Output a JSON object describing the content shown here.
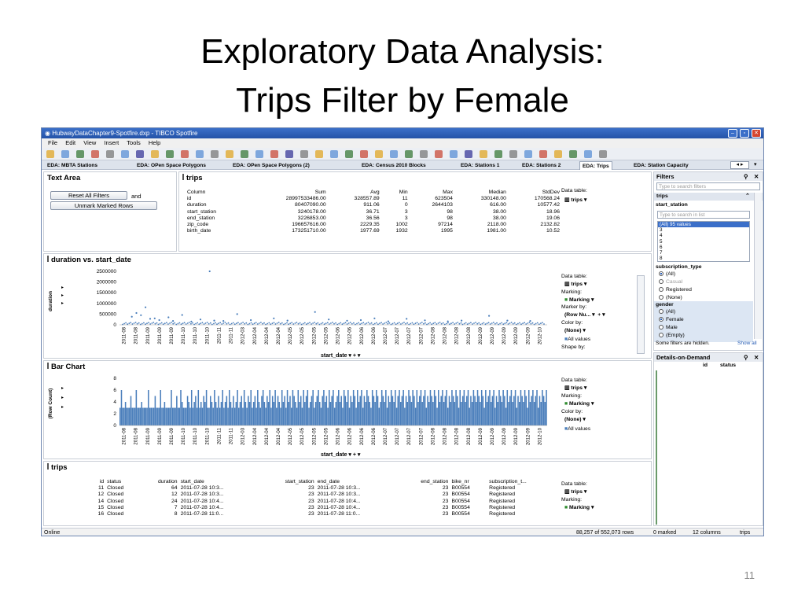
{
  "slide": {
    "title_line1": "Exploratory Data Analysis:",
    "title_line2": "Trips Filter by Female",
    "page_number": "11"
  },
  "window": {
    "title": "HubwayDataChapter9-Spotfire.dxp - TIBCO Spotfire",
    "menu": [
      "File",
      "Edit",
      "View",
      "Insert",
      "Tools",
      "Help"
    ],
    "tabs": [
      "EDA: MBTA Stations",
      "EDA: OPen Space Polygons",
      "EDA: OPen Space Polygons (2)",
      "EDA: Census 2010 Blocks",
      "EDA: Stations 1",
      "EDA: Stations 2",
      "EDA: Trips",
      "EDA: Station Capacity"
    ],
    "active_tab": "EDA: Trips"
  },
  "text_area": {
    "title": "Text Area",
    "reset_button": "Reset All Filters",
    "and_label": "and",
    "unmark_button": "Unmark Marked Rows"
  },
  "stats_table": {
    "title": "trips",
    "headers": [
      "Column",
      "Sum",
      "Avg",
      "Min",
      "Max",
      "Median",
      "StdDev"
    ],
    "rows": [
      [
        "id",
        "28997533486.00",
        "328557.89",
        "11",
        "623504",
        "330148.00",
        "170568.24"
      ],
      [
        "duration",
        "80407090.00",
        "911.06",
        "0",
        "2644103",
        "616.00",
        "10577.42"
      ],
      [
        "start_station",
        "3240178.00",
        "36.71",
        "3",
        "98",
        "38.00",
        "18.96"
      ],
      [
        "end_station",
        "3226853.00",
        "36.56",
        "3",
        "98",
        "38.00",
        "19.06"
      ],
      [
        "zip_code",
        "196657616.00",
        "2229.35",
        "1002",
        "97214",
        "2118.00",
        "2132.82"
      ],
      [
        "birth_date",
        "173251710.00",
        "1977.69",
        "1932",
        "1995",
        "1981.00",
        "10.52"
      ]
    ],
    "data_table_label": "Data table:",
    "data_table_value": "trips"
  },
  "scatter": {
    "title": "duration vs. start_date",
    "ylabel": "duration",
    "y_ticks": [
      "2500000",
      "2000000",
      "1500000",
      "1000000",
      "500000",
      "0"
    ],
    "x_axis_selector": "start_date",
    "data_table_label": "Data table:",
    "data_table_value": "trips",
    "marking_label": "Marking:",
    "marking_value": "Marking",
    "marker_by_label": "Marker by:",
    "marker_by_value": "(Row Nu...",
    "color_by_label": "Color by:",
    "color_by_value": "(None)",
    "all_values": "All values",
    "shape_by_label": "Shape by:"
  },
  "bar_chart": {
    "title": "Bar Chart",
    "ylabel": "(Row Count)",
    "y_ticks": [
      "8",
      "6",
      "4",
      "2",
      "0"
    ],
    "x_axis_selector": "start_date",
    "data_table_label": "Data table:",
    "data_table_value": "trips",
    "marking_label": "Marking:",
    "marking_value": "Marking",
    "color_by_label": "Color by:",
    "color_by_value": "(None)",
    "all_values": "All values"
  },
  "chart_data": [
    {
      "type": "scatter",
      "title": "duration vs. start_date",
      "xlabel": "start_date",
      "ylabel": "duration",
      "ylim": [
        0,
        2500000
      ],
      "x_tick_labels": [
        "2011-08",
        "2011-08",
        "2011-09",
        "2011-09",
        "2011-09",
        "2011-10",
        "2011-10",
        "2011-10",
        "2011-11",
        "2011-11",
        "2012-03",
        "2012-04",
        "2012-04",
        "2012-04",
        "2012-05",
        "2012-05",
        "2012-05",
        "2012-05",
        "2012-06",
        "2012-06",
        "2012-06",
        "2012-06",
        "2012-07",
        "2012-07",
        "2012-07",
        "2012-07",
        "2012-08",
        "2012-08",
        "2012-08",
        "2012-08",
        "2012-09",
        "2012-09",
        "2012-09",
        "2012-09",
        "2012-09",
        "2012-10"
      ],
      "highlight_points": [
        {
          "x": 2,
          "y": 380000
        },
        {
          "x": 3,
          "y": 550000
        },
        {
          "x": 4,
          "y": 450000
        },
        {
          "x": 5,
          "y": 820000
        },
        {
          "x": 6,
          "y": 280000
        },
        {
          "x": 7,
          "y": 300000
        },
        {
          "x": 8,
          "y": 220000
        },
        {
          "x": 10,
          "y": 350000
        },
        {
          "x": 11,
          "y": 180000
        },
        {
          "x": 13,
          "y": 460000
        },
        {
          "x": 15,
          "y": 150000
        },
        {
          "x": 17,
          "y": 250000
        },
        {
          "x": 19,
          "y": 2600000
        },
        {
          "x": 20,
          "y": 200000
        },
        {
          "x": 22,
          "y": 180000
        },
        {
          "x": 25,
          "y": 500000
        },
        {
          "x": 28,
          "y": 220000
        },
        {
          "x": 33,
          "y": 300000
        },
        {
          "x": 36,
          "y": 200000
        },
        {
          "x": 42,
          "y": 600000
        },
        {
          "x": 45,
          "y": 250000
        },
        {
          "x": 49,
          "y": 190000
        },
        {
          "x": 52,
          "y": 220000
        },
        {
          "x": 55,
          "y": 300000
        },
        {
          "x": 58,
          "y": 160000
        },
        {
          "x": 62,
          "y": 280000
        },
        {
          "x": 66,
          "y": 210000
        },
        {
          "x": 71,
          "y": 160000
        },
        {
          "x": 74,
          "y": 200000
        },
        {
          "x": 80,
          "y": 420000
        },
        {
          "x": 84,
          "y": 200000
        },
        {
          "x": 89,
          "y": 180000
        }
      ]
    },
    {
      "type": "bar",
      "title": "Bar Chart",
      "ylabel": "(Row Count)",
      "xlabel": "start_date",
      "ylim": [
        0,
        8
      ],
      "x_tick_labels": [
        "2011-08",
        "2011-08",
        "2011-09",
        "2011-09",
        "2011-09",
        "2011-10",
        "2011-10",
        "2011-10",
        "2011-11",
        "2011-11",
        "2012-03",
        "2012-04",
        "2012-04",
        "2012-04",
        "2012-05",
        "2012-05",
        "2012-05",
        "2012-05",
        "2012-06",
        "2012-06",
        "2012-06",
        "2012-06",
        "2012-07",
        "2012-07",
        "2012-07",
        "2012-07",
        "2012-08",
        "2012-08",
        "2012-08",
        "2012-08",
        "2012-09",
        "2012-09",
        "2012-09",
        "2012-09",
        "2012-09",
        "2012-10"
      ],
      "values": [
        3,
        6,
        3,
        3,
        4,
        3,
        3,
        3,
        5,
        3,
        3,
        3,
        6,
        3,
        3,
        3,
        4,
        3,
        3,
        3,
        3,
        6,
        3,
        3,
        3,
        3,
        5,
        3,
        3,
        3,
        6,
        3,
        3,
        4,
        3,
        3,
        3,
        3,
        6,
        3,
        3,
        3,
        5,
        3,
        3,
        6,
        4,
        3,
        3,
        3,
        5,
        4,
        3,
        6,
        3,
        4,
        5,
        3,
        6,
        3,
        4,
        3,
        5,
        4,
        6,
        3,
        3,
        5,
        4,
        3,
        6,
        4,
        3,
        5,
        3,
        4,
        6,
        3,
        4,
        5,
        3,
        6,
        4,
        3,
        5,
        3,
        4,
        6,
        3,
        4,
        5,
        3,
        6,
        4,
        3,
        5,
        4,
        6,
        3,
        4,
        5,
        3,
        6,
        4,
        3,
        5,
        6,
        4,
        3,
        5,
        4,
        6,
        3,
        5,
        4,
        6,
        3,
        5,
        4,
        3,
        6,
        4,
        5,
        3,
        6,
        4,
        5,
        3,
        6,
        5,
        4,
        3,
        6,
        4,
        5,
        3,
        6,
        4,
        5,
        6,
        3,
        4,
        5,
        6,
        3,
        4,
        5,
        6,
        4,
        3,
        5,
        6,
        4,
        5,
        3,
        6,
        4,
        5,
        6,
        3,
        4,
        5,
        6,
        4,
        5,
        3,
        6,
        5,
        4,
        6,
        3,
        5,
        4,
        6,
        5,
        3,
        6,
        4,
        5,
        6,
        3,
        5,
        4,
        6,
        5,
        4,
        3,
        6,
        5,
        4,
        6,
        5,
        3,
        4,
        6,
        5,
        4,
        6,
        3,
        5,
        4,
        6,
        5,
        4,
        6,
        3,
        5,
        6,
        4,
        5,
        6,
        3,
        5,
        4,
        6,
        5,
        4,
        6,
        5,
        3,
        6,
        4,
        5,
        6,
        4,
        5,
        6,
        3,
        5,
        4,
        6,
        5,
        4,
        6,
        5,
        3,
        6,
        4,
        5,
        6,
        4,
        5,
        6,
        3,
        5,
        4,
        6,
        5,
        4,
        6,
        5,
        3,
        6,
        4,
        5,
        6,
        4,
        5,
        6,
        3,
        5,
        4,
        6,
        5,
        4,
        6,
        5,
        4,
        6,
        5,
        3,
        6,
        4,
        5,
        6,
        4,
        5,
        6,
        3,
        5,
        4,
        6,
        5,
        4,
        6,
        5,
        3,
        6,
        4,
        5,
        6,
        4,
        5,
        6,
        3,
        5,
        4,
        6,
        5,
        4,
        6,
        5,
        3,
        6,
        4,
        5,
        6,
        4,
        5,
        6,
        3,
        5,
        4,
        6,
        5,
        4,
        6
      ]
    }
  ],
  "trips_table": {
    "title": "trips",
    "headers": [
      "id",
      "status",
      "duration",
      "start_date",
      "start_station",
      "end_date",
      "end_station",
      "bike_nr",
      "subscription_t..."
    ],
    "rows": [
      [
        "11",
        "Closed",
        "64",
        "2011-07-28 10:3...",
        "23",
        "2011-07-28 10:3...",
        "23",
        "B00554",
        "Registered"
      ],
      [
        "12",
        "Closed",
        "12",
        "2011-07-28 10:3...",
        "23",
        "2011-07-28 10:3...",
        "23",
        "B00554",
        "Registered"
      ],
      [
        "14",
        "Closed",
        "24",
        "2011-07-28 10:4...",
        "23",
        "2011-07-28 10:4...",
        "23",
        "B00554",
        "Registered"
      ],
      [
        "15",
        "Closed",
        "7",
        "2011-07-28 10:4...",
        "23",
        "2011-07-28 10:4...",
        "23",
        "B00554",
        "Registered"
      ],
      [
        "16",
        "Closed",
        "8",
        "2011-07-28 11:0...",
        "23",
        "2011-07-28 11:0...",
        "23",
        "B00554",
        "Registered"
      ]
    ],
    "data_table_label": "Data table:",
    "data_table_value": "trips",
    "marking_label": "Marking:",
    "marking_value": "Marking"
  },
  "filters": {
    "title": "Filters",
    "search_placeholder": "Type to search filters",
    "table_name": "trips",
    "start_station_label": "start_station",
    "list_search_placeholder": "Type to search in list",
    "list_items": [
      "(All) 95 values",
      "3",
      "4",
      "5",
      "6",
      "7",
      "8"
    ],
    "subscription_label": "subscription_type",
    "subscription_options": [
      "(All)",
      "Casual",
      "Registered",
      "(None)"
    ],
    "gender_label": "gender",
    "gender_options": [
      "(All)",
      "Female",
      "Male",
      "(Empty)"
    ],
    "hidden_note": "Some filters are hidden.",
    "show_all": "Show all"
  },
  "details": {
    "title": "Details-on-Demand",
    "col1": "id",
    "col2": "status"
  },
  "status_bar": {
    "left": "Online",
    "rows": "88,257 of 552,073 rows",
    "marked": "0 marked",
    "columns": "12 columns",
    "table": "trips"
  },
  "colors": {
    "accent": "#4a7ebb",
    "marking": "#2e8b2e",
    "titlebar": "#2c5db3"
  }
}
